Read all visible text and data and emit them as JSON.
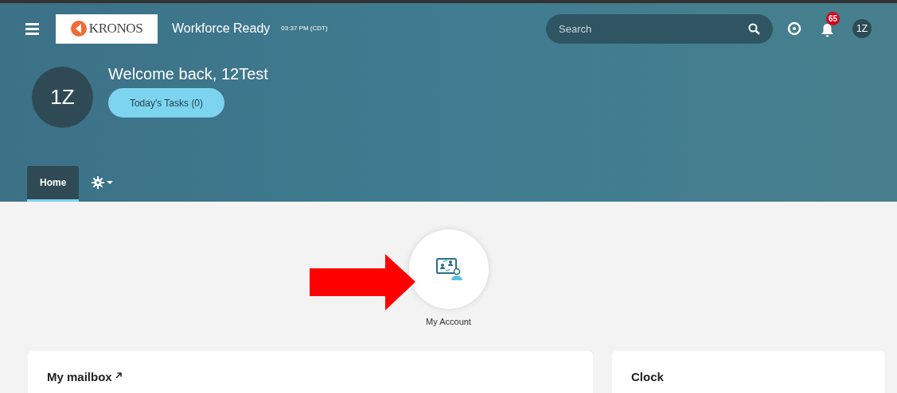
{
  "top_bar": {
    "logo": "KRONOS",
    "app_title": "Workforce Ready",
    "time": "03:37 PM (CDT)",
    "search": {
      "placeholder": "Search"
    },
    "notifications": {
      "count": "65"
    },
    "user_initials": "1Z"
  },
  "welcome": {
    "avatar": "1Z",
    "greeting": "Welcome back, 12Test",
    "tasks_button": "Today's Tasks (0)"
  },
  "tabs": [
    {
      "kind": "text",
      "label": "Home",
      "selected": true
    },
    {
      "kind": "gear",
      "selected": false
    }
  ],
  "shortcut": {
    "label": "My Account"
  },
  "cards": [
    {
      "title": "My mailbox",
      "link": true
    },
    {
      "title": "Clock",
      "link": false
    }
  ]
}
